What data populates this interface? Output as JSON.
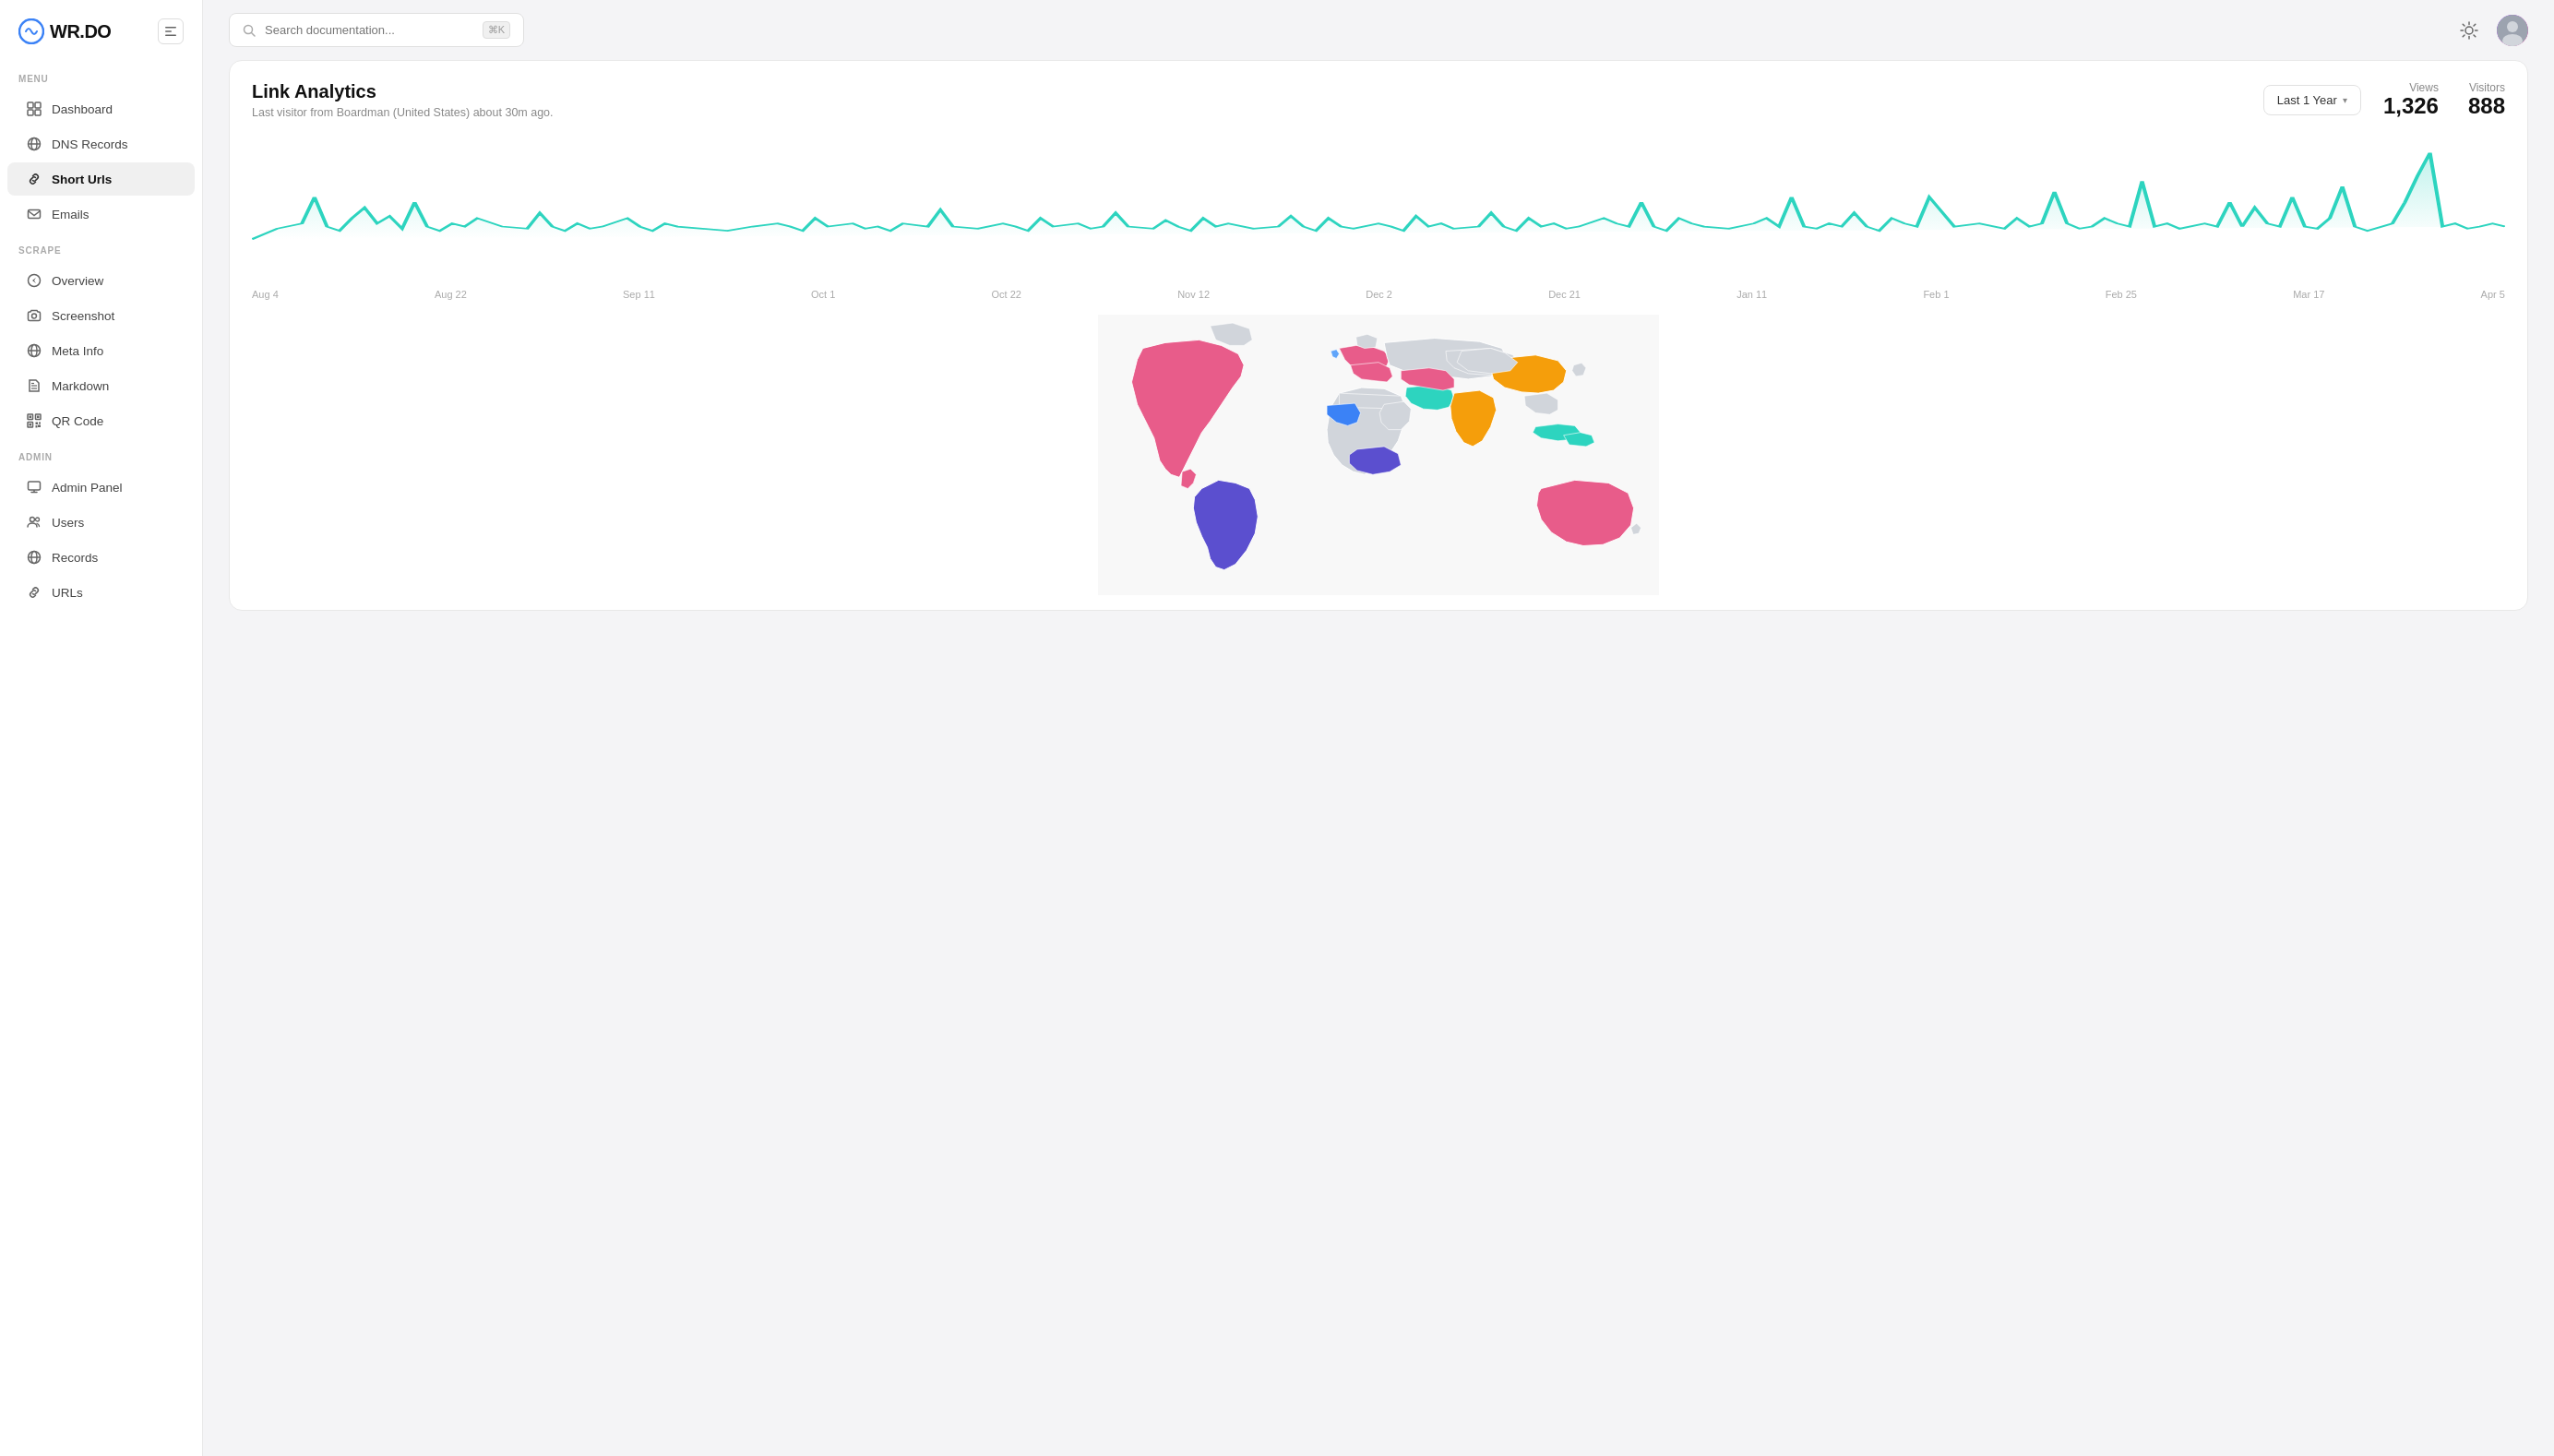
{
  "logo": {
    "text": "WR.DO"
  },
  "sidebar": {
    "toggle_label": "Toggle Sidebar",
    "sections": [
      {
        "label": "MENU",
        "items": [
          {
            "id": "dashboard",
            "label": "Dashboard",
            "icon": "grid"
          },
          {
            "id": "dns-records",
            "label": "DNS Records",
            "icon": "globe"
          },
          {
            "id": "short-urls",
            "label": "Short Urls",
            "icon": "link",
            "active": true
          },
          {
            "id": "emails",
            "label": "Emails",
            "icon": "mail"
          }
        ]
      },
      {
        "label": "SCRAPE",
        "items": [
          {
            "id": "overview",
            "label": "Overview",
            "icon": "compass"
          },
          {
            "id": "screenshot",
            "label": "Screenshot",
            "icon": "camera"
          },
          {
            "id": "meta-info",
            "label": "Meta Info",
            "icon": "globe"
          },
          {
            "id": "markdown",
            "label": "Markdown",
            "icon": "file-text"
          },
          {
            "id": "qr-code",
            "label": "QR Code",
            "icon": "grid-small"
          }
        ]
      },
      {
        "label": "ADMIN",
        "items": [
          {
            "id": "admin-panel",
            "label": "Admin Panel",
            "icon": "monitor"
          },
          {
            "id": "users",
            "label": "Users",
            "icon": "users"
          },
          {
            "id": "records",
            "label": "Records",
            "icon": "globe"
          },
          {
            "id": "urls",
            "label": "URLs",
            "icon": "link"
          }
        ]
      }
    ]
  },
  "topbar": {
    "search_placeholder": "Search documentation...",
    "kbd_shortcut": "⌘K"
  },
  "analytics": {
    "title": "Link Analytics",
    "subtitle": "Last visitor from Boardman (United States) about 30m ago.",
    "time_selector": "Last 1 Year",
    "views_label": "Views",
    "views_value": "1,326",
    "visitors_label": "Visitors",
    "visitors_value": "888",
    "chart_labels": [
      "Aug 4",
      "Aug 22",
      "Sep 11",
      "Oct 1",
      "Oct 22",
      "Nov 12",
      "Dec 2",
      "Dec 21",
      "Jan 11",
      "Feb 1",
      "Feb 25",
      "Mar 17",
      "Apr 5"
    ]
  }
}
